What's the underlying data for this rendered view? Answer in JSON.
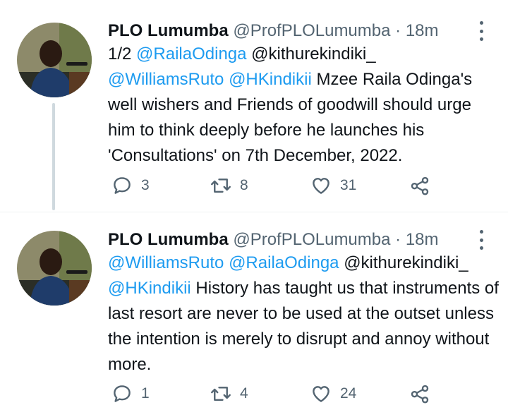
{
  "colors": {
    "mention": "#1d9bf0",
    "text": "#0f1419",
    "muted": "#536471"
  },
  "tweets": [
    {
      "name": "PLO Lumumba",
      "handle": "@ProfPLOLumumba",
      "separator": "·",
      "time": "18m",
      "prefix": "1/2",
      "mentions": [
        "@RailaOdinga",
        "@kithurekindiki_",
        "@WilliamsRuto",
        "@HKindikii"
      ],
      "text": "Mzee Raila Odinga's well wishers and Friends of goodwill should urge him to think deeply before he launches his 'Consultations' on 7th December, 2022.",
      "replies": "3",
      "retweets": "8",
      "likes": "31"
    },
    {
      "name": "PLO Lumumba",
      "handle": "@ProfPLOLumumba",
      "separator": "·",
      "time": "18m",
      "mentions": [
        "@WilliamsRuto",
        "@RailaOdinga",
        "@kithurekindiki_",
        "@HKindikii"
      ],
      "text": "History has taught us that instruments of last resort are never to be used at the outset unless the intention is merely to disrupt and annoy without more.",
      "replies": "1",
      "retweets": "4",
      "likes": "24"
    }
  ],
  "icons": {
    "reply": "reply-icon",
    "retweet": "retweet-icon",
    "like": "heart-icon",
    "share": "share-icon",
    "more": "more-options-icon"
  }
}
